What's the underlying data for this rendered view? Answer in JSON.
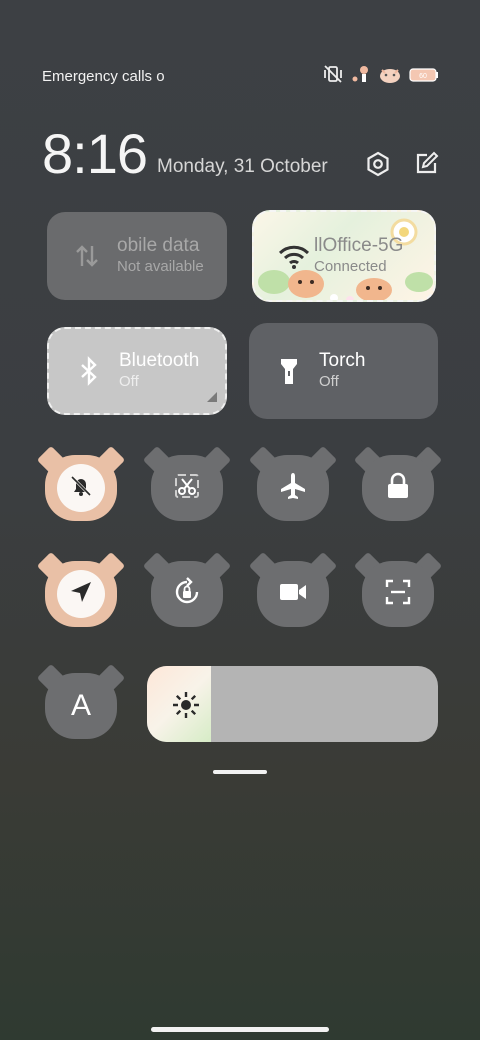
{
  "status_bar": {
    "text": "Emergency calls o",
    "icons": [
      "vibrate-icon",
      "sticker-icon",
      "sticker-icon",
      "battery-icon"
    ]
  },
  "header": {
    "time": "8:16",
    "date": "Monday, 31 October",
    "settings_icon": "settings-icon",
    "edit_icon": "edit-icon"
  },
  "tiles": {
    "mobile_data": {
      "label": "obile data",
      "status": "Not available",
      "icon": "swap-vert-icon"
    },
    "wifi": {
      "label": "llOffice-5G",
      "status": "Connected",
      "icon": "wifi-icon"
    },
    "bluetooth": {
      "label": "Bluetooth",
      "status": "Off",
      "icon": "bluetooth-icon"
    },
    "torch": {
      "label": "Torch",
      "status": "Off",
      "icon": "flashlight-icon"
    }
  },
  "toggles": [
    {
      "name": "silent-toggle",
      "icon": "bell-off-icon",
      "active": true
    },
    {
      "name": "screenshot-toggle",
      "icon": "scissors-icon",
      "active": false
    },
    {
      "name": "airplane-toggle",
      "icon": "airplane-icon",
      "active": false
    },
    {
      "name": "lock-toggle",
      "icon": "lock-icon",
      "active": false
    },
    {
      "name": "location-toggle",
      "icon": "navigation-icon",
      "active": true
    },
    {
      "name": "rotation-toggle",
      "icon": "rotation-lock-icon",
      "active": false
    },
    {
      "name": "screen-record-toggle",
      "icon": "video-icon",
      "active": false
    },
    {
      "name": "scanner-toggle",
      "icon": "scan-icon",
      "active": false
    },
    {
      "name": "font-toggle",
      "icon": "letter-a-icon",
      "active": false,
      "label": "A"
    }
  ],
  "brightness": {
    "icon": "brightness-icon",
    "level": 0.22
  },
  "colors": {
    "accent_pink": "#e9c0a6",
    "tile_gray": "#6d6e70"
  }
}
